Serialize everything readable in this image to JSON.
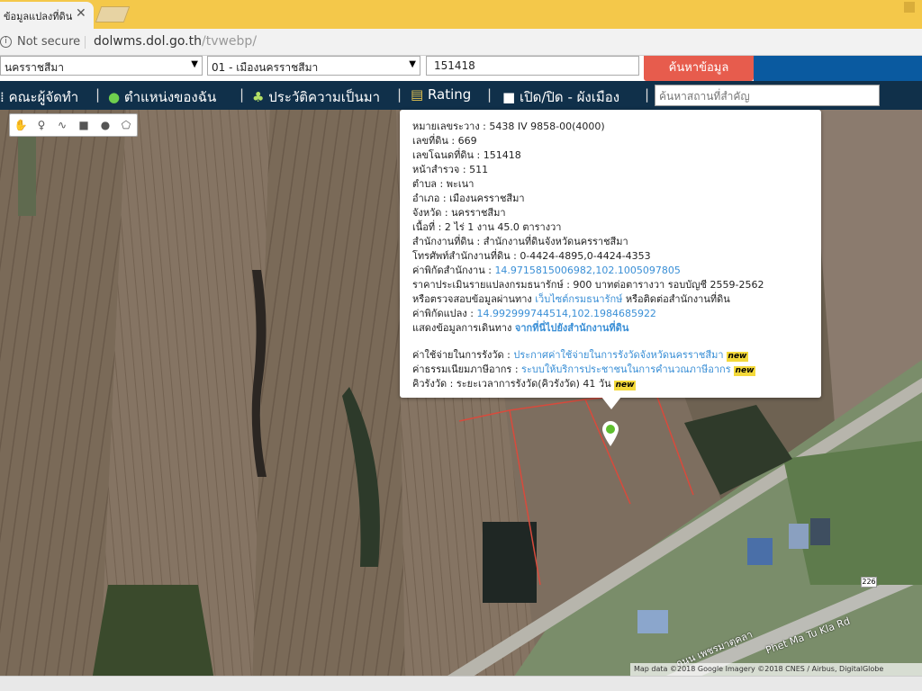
{
  "browser": {
    "tab_title": "ข้อมูลแปลงที่ดิน",
    "not_secure": "Not secure",
    "url_host": "dolwms.dol.go.th",
    "url_path": "/tvwebp/"
  },
  "form": {
    "province": "นครราชสีมา",
    "district": "01 - เมืองนครราชสีมา",
    "deed_number": "151418",
    "search_label": "ค้นหาข้อมูล"
  },
  "nav": {
    "items": [
      {
        "label": "คณะผู้จัดทำ",
        "icon": "people-icon"
      },
      {
        "label": "ตำแหน่งของฉัน",
        "icon": "globe-icon"
      },
      {
        "label": "ประวัติความเป็นมา",
        "icon": "plant-icon"
      },
      {
        "label": "Rating",
        "icon": "chart-icon"
      },
      {
        "label": "เปิด/ปิด - ผังเมือง",
        "icon": "checkbox-icon"
      }
    ],
    "search_placeholder": "ค้นหาสถานที่สำคัญ"
  },
  "map_tools": [
    "hand-icon",
    "pin-icon",
    "line-icon",
    "rectangle-icon",
    "circle-icon",
    "polygon-icon"
  ],
  "popup": {
    "rows": [
      {
        "label": "หมายเลขระวาง : ",
        "value": "5438 IV 9858-00(4000)"
      },
      {
        "label": "เลขที่ดิน : ",
        "value": "669"
      },
      {
        "label": "เลขโฉนดที่ดิน : ",
        "value": "151418"
      },
      {
        "label": "หน้าสำรวจ : ",
        "value": "511"
      },
      {
        "label": "ตำบล : ",
        "value": "พะเนา"
      },
      {
        "label": "อำเภอ : ",
        "value": "เมืองนครราชสีมา"
      },
      {
        "label": "จังหวัด : ",
        "value": "นครราชสีมา"
      },
      {
        "label": "เนื้อที่ : ",
        "value": "2 ไร่ 1 งาน 45.0 ตารางวา"
      },
      {
        "label": "สำนักงานที่ดิน : ",
        "value": "สำนักงานที่ดินจังหวัดนครราชสีมา"
      },
      {
        "label": "โทรศัพท์สำนักงานที่ดิน : ",
        "value": "0-4424-4895,0-4424-4353"
      },
      {
        "label": "ค่าพิกัดสำนักงาน : ",
        "value": "14.9715815006982,102.1005097805"
      },
      {
        "label": "ราคาประเมินรายแปลงกรมธนารักษ์ : ",
        "value": "900 บาทต่อตารางวา รอบบัญชี 2559-2562"
      },
      {
        "label": "หรือตรวจสอบข้อมูลผ่านทาง ",
        "value": "เว็บไซต์กรมธนารักษ์",
        "suffix": " หรือติดต่อสำนักงานที่ดิน"
      },
      {
        "label": "ค่าพิกัดแปลง : ",
        "value": "14.992999744514,102.1984685922"
      },
      {
        "label": "แสดงข้อมูลการเดินทาง ",
        "value": "จากที่นี่ไปยังสำนักงานที่ดิน"
      },
      {
        "label": "ค่าใช้จ่ายในการรังวัด : ",
        "value": "ประกาศค่าใช้จ่ายในการรังวัดจังหวัดนครราชสีมา",
        "badge": "new"
      },
      {
        "label": "ค่าธรรมเนียมภาษีอากร : ",
        "value": "ระบบให้บริการประชาชนในการคำนวณภาษีอากร",
        "badge": "new"
      },
      {
        "label": "คิวรังวัด : ",
        "value": "ระยะเวลาการรังวัด(คิวรังวัด) 41 วัน",
        "badge": "new"
      }
    ]
  },
  "map": {
    "road_label_1": "Phet Ma Tu Kla Rd",
    "road_label_2": "ถนน เพชรมาตุคลา",
    "route_number": "226",
    "copyright": "Map data ©2018 Google Imagery ©2018 CNES / Airbus, DigitalGlobe"
  },
  "colors": {
    "nav_bg": "#10304a",
    "search_button": "#e75c4d",
    "link": "#3a8fd6",
    "tabbar": "#f4c84a"
  }
}
